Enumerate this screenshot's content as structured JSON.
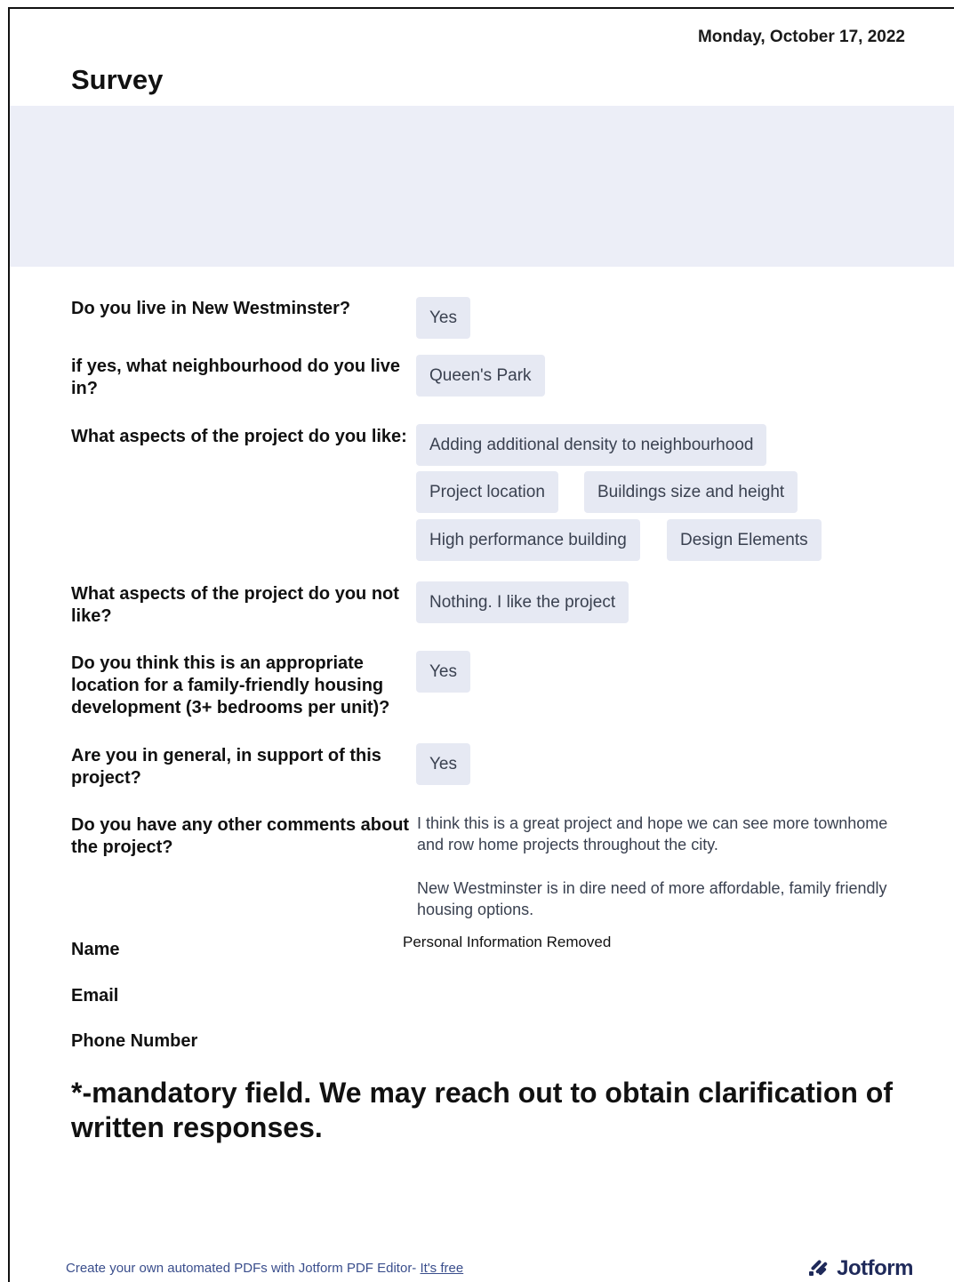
{
  "header": {
    "date": "Monday, October 17, 2022",
    "title": "Survey"
  },
  "questions": [
    {
      "label": "Do you live in New Westminster?",
      "answers": [
        "Yes"
      ]
    },
    {
      "label": "if yes, what neighbourhood do you live in?",
      "answers": [
        "Queen's Park"
      ]
    },
    {
      "label": "What aspects of the project do you like:",
      "answers": [
        "Adding additional density to neighbourhood",
        "Project location",
        "Buildings size and height",
        "High performance building",
        "Design Elements"
      ]
    },
    {
      "label": "What aspects of the project do you not like?",
      "answers": [
        "Nothing. I like the project"
      ]
    },
    {
      "label": "Do you think this is an appropriate location for a family-friendly housing development (3+ bedrooms per unit)?",
      "answers": [
        "Yes"
      ]
    },
    {
      "label": "Are you in general, in support of this project?",
      "answers": [
        "Yes"
      ]
    },
    {
      "label": "Do you have any other comments about the project?",
      "paragraphs": [
        "I think this is a great project and hope we can see more townhome and row home projects throughout the city.",
        "New Westminster is in dire need of more affordable, family friendly housing options."
      ]
    }
  ],
  "contact": {
    "name_label": "Name",
    "email_label": "Email",
    "phone_label": "Phone Number",
    "removed_notice": "Personal Information Removed"
  },
  "mandatory_note": "*-mandatory field. We may reach out to obtain clarification of written responses.",
  "footer": {
    "text": "Create your own automated PDFs with Jotform PDF Editor-",
    "link": "It's free",
    "brand": "Jotform",
    "brand_icon": "jotform-logo-icon"
  },
  "colors": {
    "banner": "#eceef7",
    "chip": "#e6e9f3",
    "chip_text": "#3a4150",
    "footer": "#3a4e8c"
  }
}
